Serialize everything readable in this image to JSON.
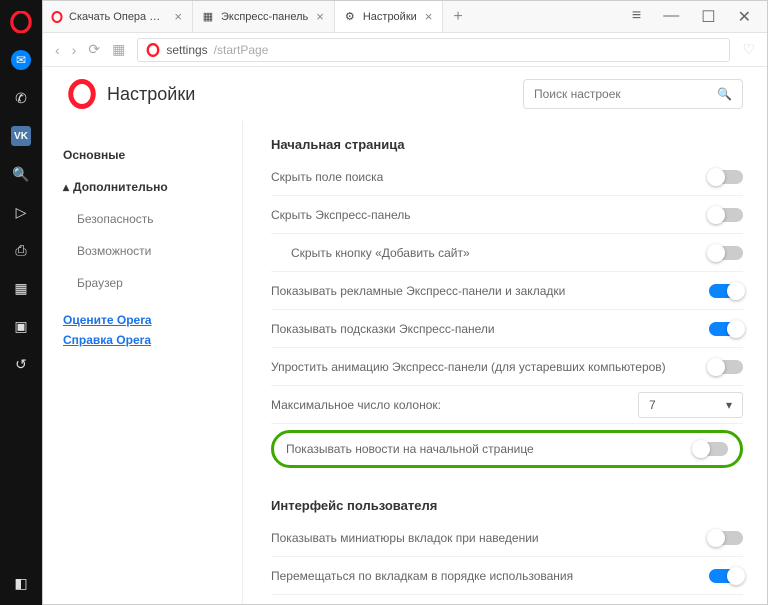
{
  "tabs": [
    {
      "icon": "opera",
      "label": "Скачать Опера для комп"
    },
    {
      "icon": "speed",
      "label": "Экспресс-панель"
    },
    {
      "icon": "gear",
      "label": "Настройки",
      "active": true
    }
  ],
  "address": {
    "protocol_icon": "opera",
    "host": "settings",
    "path": "/startPage"
  },
  "page_title": "Настройки",
  "search_placeholder": "Поиск настроек",
  "nav": {
    "basic": "Основные",
    "advanced": "Дополнительно",
    "security": "Безопасность",
    "features": "Возможности",
    "browser": "Браузер",
    "rate": "Оцените Opera",
    "help": "Справка Opera"
  },
  "sections": {
    "start_page": {
      "title": "Начальная страница",
      "rows": [
        {
          "key": "hide_search",
          "label": "Скрыть поле поиска",
          "type": "toggle",
          "value": false
        },
        {
          "key": "hide_speed",
          "label": "Скрыть Экспресс-панель",
          "type": "toggle",
          "value": false
        },
        {
          "key": "hide_add_site",
          "label": "Скрыть кнопку «Добавить сайт»",
          "type": "toggle",
          "value": false,
          "indent": true
        },
        {
          "key": "show_ads",
          "label": "Показывать рекламные Экспресс-панели и закладки",
          "type": "toggle",
          "value": true
        },
        {
          "key": "show_hints",
          "label": "Показывать подсказки Экспресс-панели",
          "type": "toggle",
          "value": true
        },
        {
          "key": "simplify_anim",
          "label": "Упростить анимацию Экспресс-панели (для устаревших компьютеров)",
          "type": "toggle",
          "value": false
        },
        {
          "key": "max_cols",
          "label": "Максимальное число колонок:",
          "type": "select",
          "value": "7"
        },
        {
          "key": "show_news",
          "label": "Показывать новости на начальной странице",
          "type": "toggle",
          "value": false,
          "highlighted": true
        }
      ]
    },
    "ui": {
      "title": "Интерфейс пользователя",
      "rows": [
        {
          "key": "show_thumbs",
          "label": "Показывать миниатюры вкладок при наведении",
          "type": "toggle",
          "value": false
        },
        {
          "key": "cycle_tabs",
          "label": "Перемещаться по вкладкам в порядке использования",
          "type": "toggle",
          "value": true
        }
      ]
    }
  }
}
